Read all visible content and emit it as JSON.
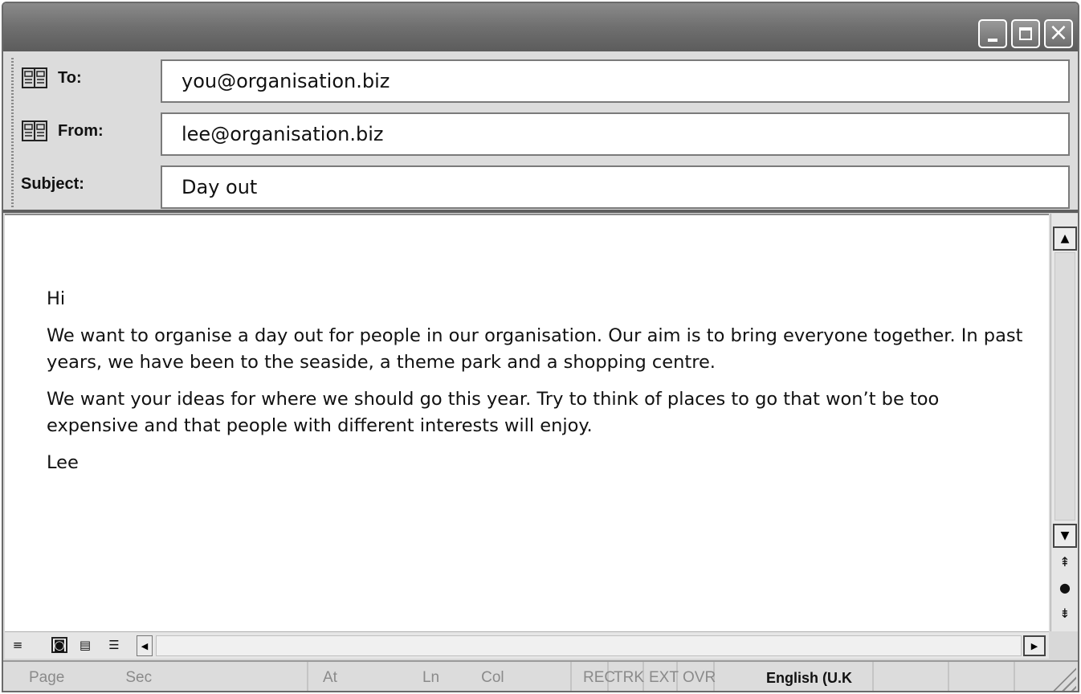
{
  "header": {
    "to_label": "To:",
    "to_value": "you@organisation.biz",
    "from_label": "From:",
    "from_value": "lee@organisation.biz",
    "subject_label": "Subject:",
    "subject_value": "Day out"
  },
  "message": {
    "greeting": "Hi",
    "paragraph1": "We want to organise a day out for people in our organisation. Our aim is to bring everyone together. In past years, we have been to the seaside, a theme park and a shopping centre.",
    "paragraph2": "We want your ideas for where we should go this year. Try to think of places to go that won’t be too expensive and that people with different interests will enjoy.",
    "signoff": "Lee"
  },
  "statusbar": {
    "page": "Page",
    "sec": "Sec",
    "at": "At",
    "ln": "Ln",
    "col": "Col",
    "rec": "REC",
    "trk": "TRK",
    "ext": "EXT",
    "ovr": "OVR",
    "language": "English (U.K"
  },
  "icons": {
    "address_book": "address-book-icon",
    "minimize": "minimize-icon",
    "maximize": "maximize-icon",
    "close": "close-icon"
  }
}
